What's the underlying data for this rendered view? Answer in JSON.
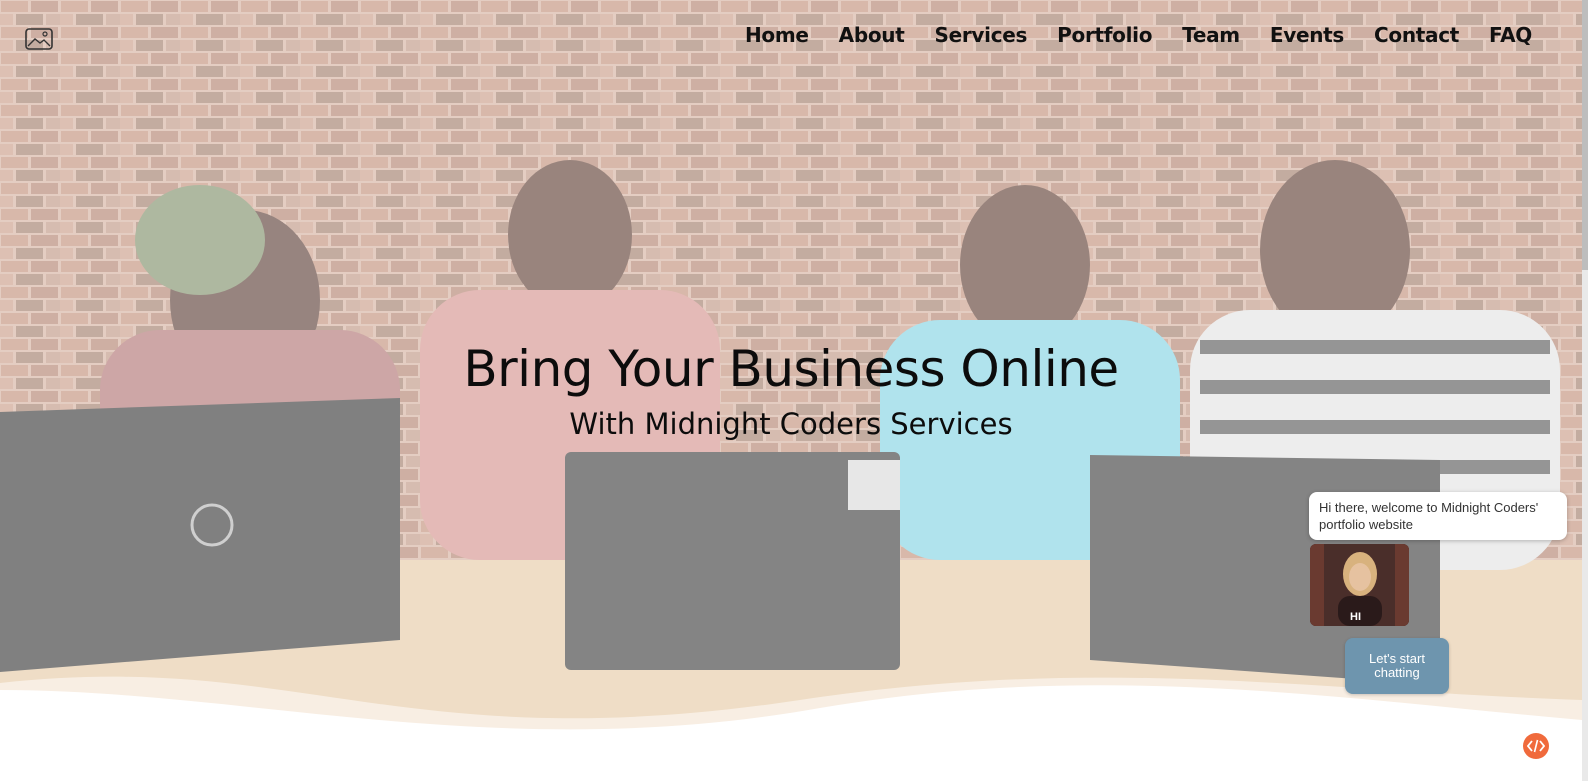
{
  "nav": {
    "logo_icon": "image-icon",
    "items": [
      {
        "label": "Home"
      },
      {
        "label": "About"
      },
      {
        "label": "Services"
      },
      {
        "label": "Portfolio"
      },
      {
        "label": "Team"
      },
      {
        "label": "Events"
      },
      {
        "label": "Contact"
      },
      {
        "label": "FAQ"
      }
    ]
  },
  "hero": {
    "title": "Bring Your Business Online",
    "subtitle": "With Midnight Coders Services"
  },
  "chat": {
    "greeting": "Hi there, welcome to Midnight Coders' portfolio website",
    "avatar_caption": "HI",
    "button_label": "Let's start chatting"
  },
  "fab": {
    "icon": "code-icon",
    "color": "#f06a3c"
  },
  "colors": {
    "chat_button": "#6e95ae",
    "text": "#0c0c0c"
  }
}
